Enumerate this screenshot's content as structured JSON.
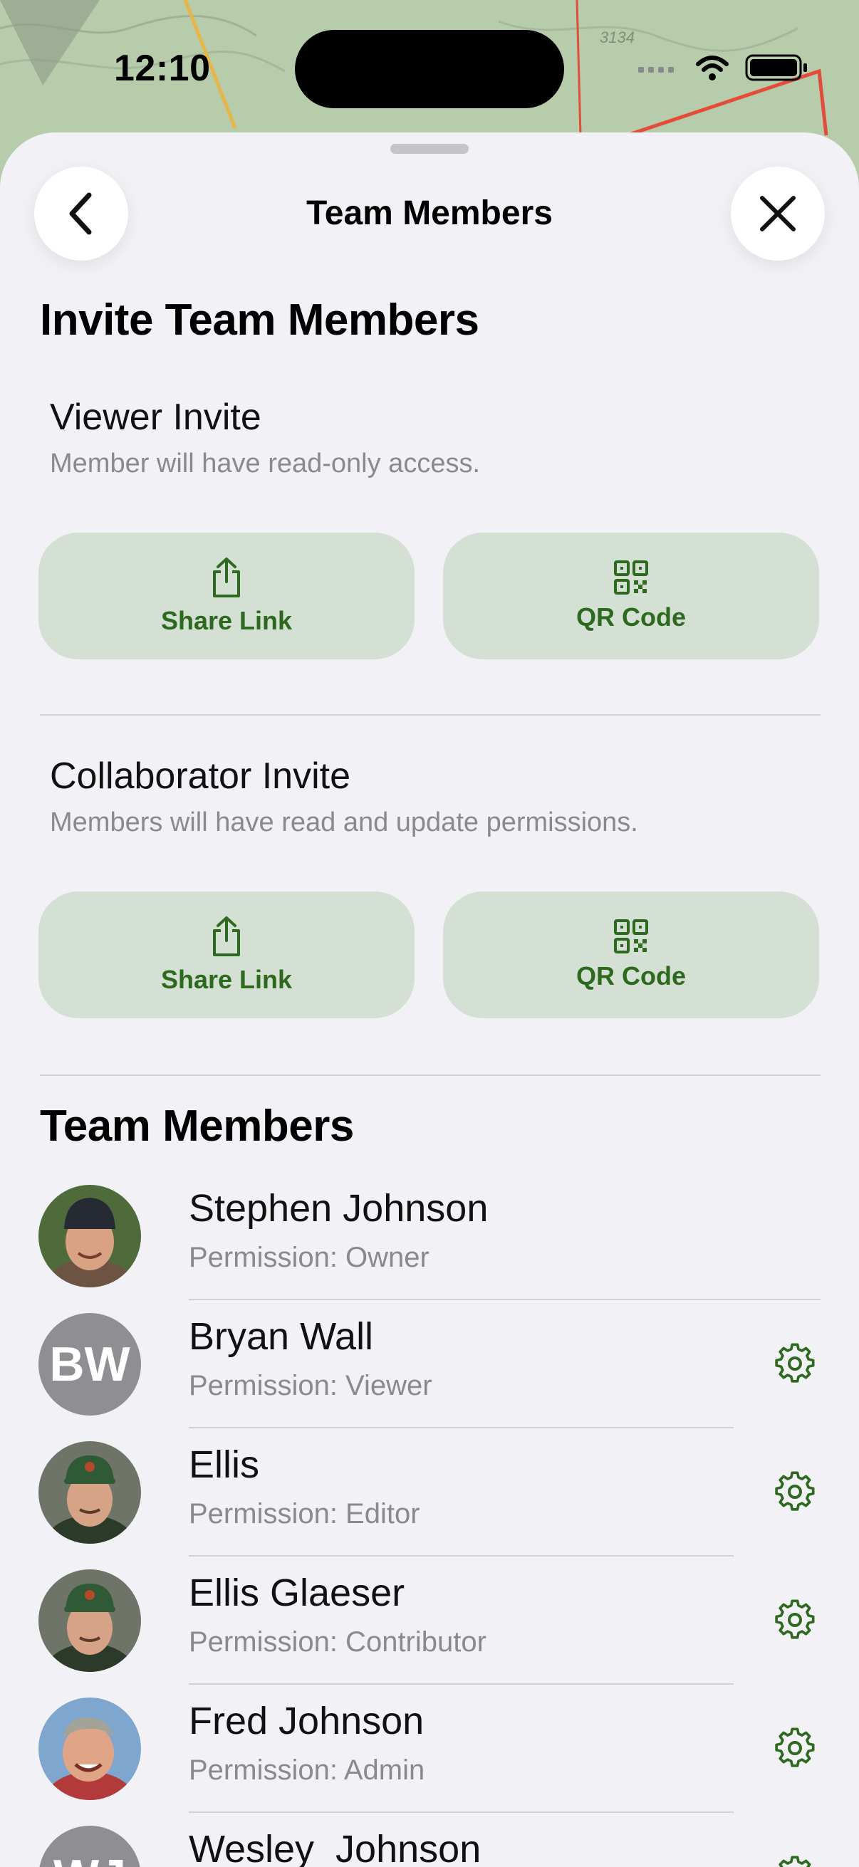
{
  "status_bar": {
    "time": "12:10"
  },
  "map": {
    "elevation_label": "3134"
  },
  "sheet": {
    "nav_title": "Team Members",
    "back_icon": "chevron-left-icon",
    "close_icon": "close-icon"
  },
  "invite": {
    "heading": "Invite Team Members",
    "viewer": {
      "title": "Viewer Invite",
      "subtitle": "Member will have read-only access.",
      "share_label": "Share Link",
      "qr_label": "QR Code"
    },
    "collaborator": {
      "title": "Collaborator Invite",
      "subtitle": "Members will have read and update permissions.",
      "share_label": "Share Link",
      "qr_label": "QR Code"
    }
  },
  "members": {
    "heading": "Team Members",
    "list": [
      {
        "name": "Stephen Johnson",
        "permission": "Permission: Owner",
        "avatar": "photo",
        "has_settings": false
      },
      {
        "name": "Bryan Wall",
        "permission": "Permission: Viewer",
        "avatar": "initials",
        "initials": "BW",
        "has_settings": true
      },
      {
        "name": "Ellis",
        "permission": "Permission: Editor",
        "avatar": "photo",
        "has_settings": true
      },
      {
        "name": "Ellis Glaeser",
        "permission": "Permission: Contributor",
        "avatar": "photo",
        "has_settings": true
      },
      {
        "name": "Fred Johnson",
        "permission": "Permission: Admin",
        "avatar": "photo",
        "has_settings": true
      },
      {
        "name": "Wesley  Johnson",
        "permission": "",
        "avatar": "initials",
        "initials": "WJ",
        "has_settings": true
      }
    ]
  },
  "colors": {
    "accent_green": "#2d6a1f",
    "button_bg": "#d5e0d4",
    "sheet_bg": "#f2f1f6",
    "secondary_text": "#8a8a8e"
  }
}
